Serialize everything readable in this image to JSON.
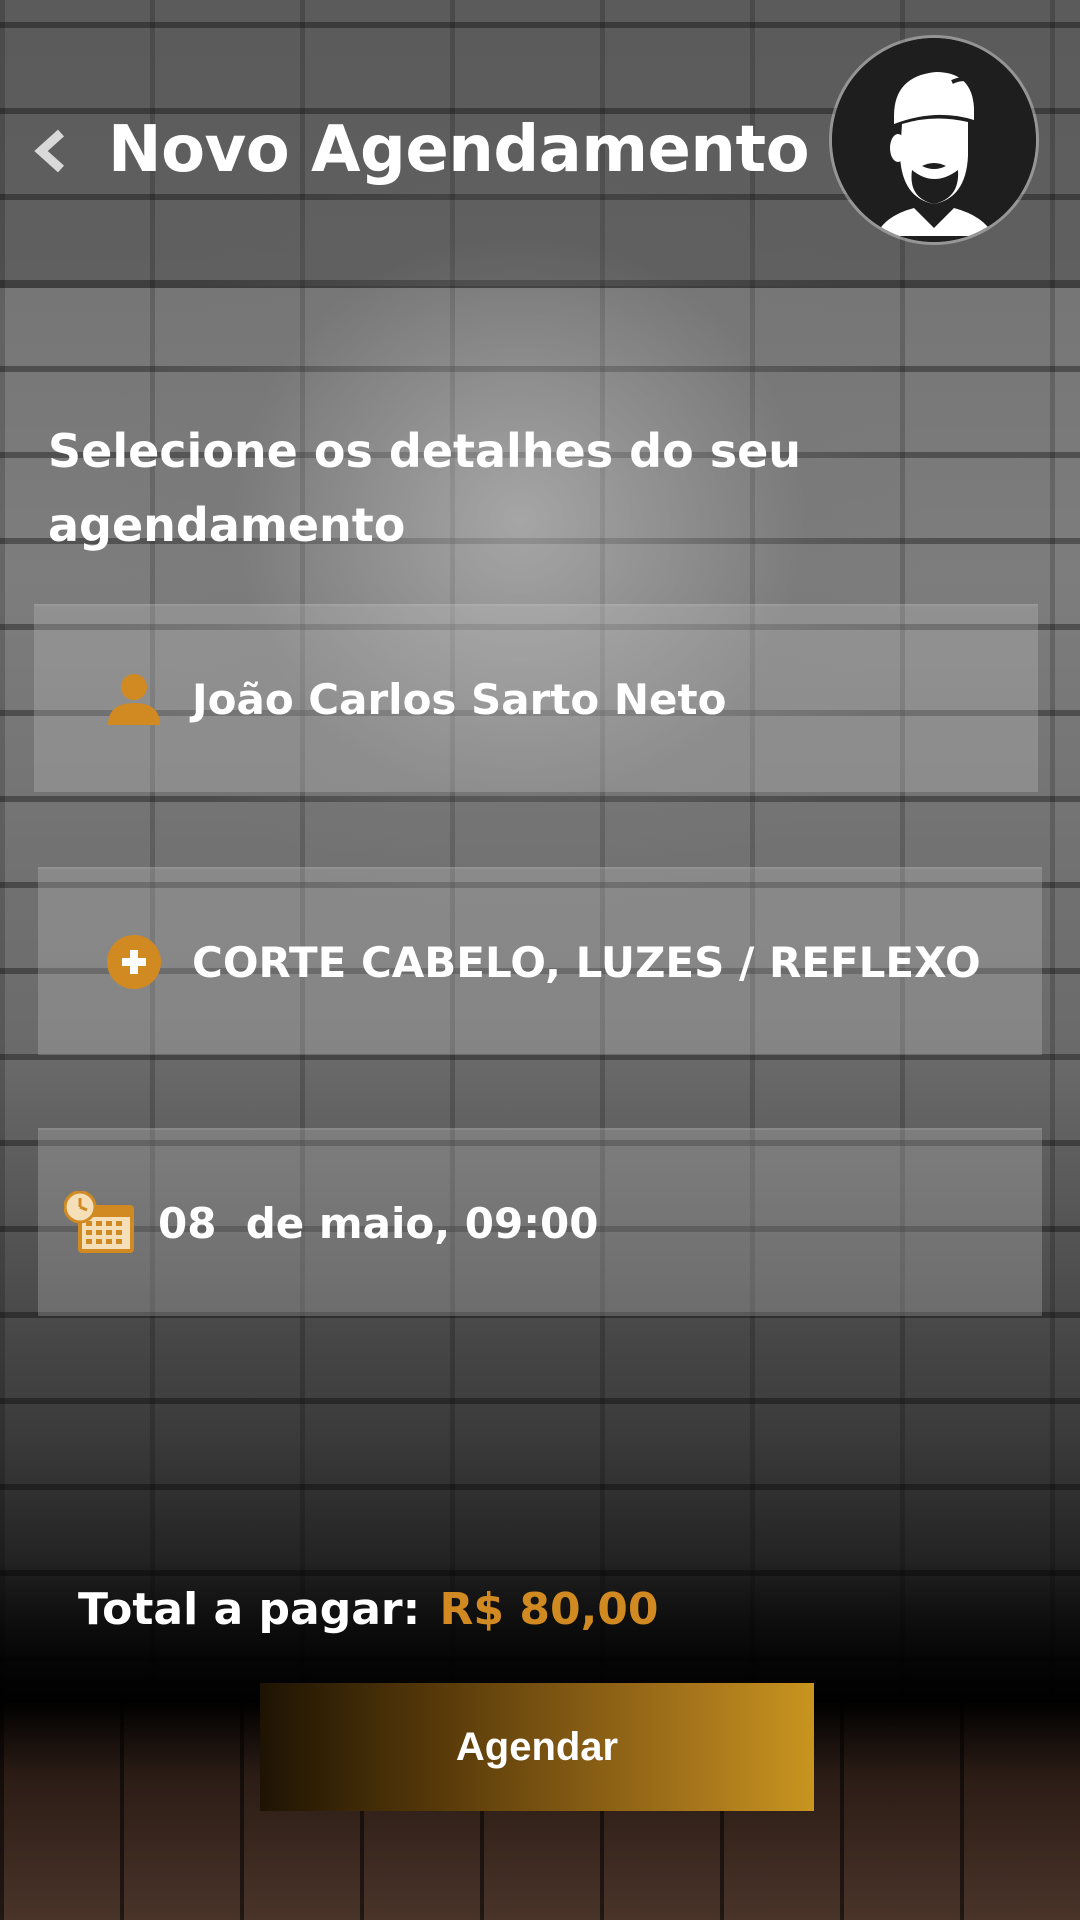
{
  "header": {
    "title": "Novo Agendamento",
    "back_icon": "chevron-left-icon",
    "avatar_icon": "barber-avatar-icon"
  },
  "main": {
    "subtitle": "Selecione os detalhes do seu agendamento",
    "fields": [
      {
        "icon": "person-icon",
        "value": "João Carlos Sarto Neto"
      },
      {
        "icon": "add-circle-icon",
        "value": "CORTE CABELO, LUZES / REFLEXO"
      },
      {
        "icon": "calendar-clock-icon",
        "value": "08  de maio, 09:00"
      }
    ]
  },
  "footer": {
    "total_label": "Total a pagar:",
    "total_value": "R$ 80,00",
    "button_label": "Agendar"
  },
  "colors": {
    "accent": "#d18a21",
    "button_start": "#1e1303",
    "button_end": "#c8951e"
  }
}
